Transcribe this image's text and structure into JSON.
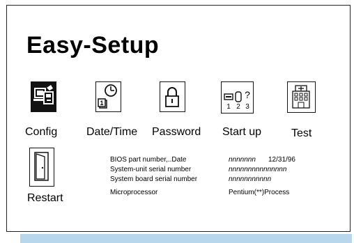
{
  "title": "Easy-Setup",
  "icons": {
    "config": "Config",
    "datetime": "Date/Time",
    "password": "Password",
    "startup": "Start up",
    "test": "Test",
    "restart": "Restart"
  },
  "startup_digits": [
    "1",
    "2",
    "3"
  ],
  "info": [
    {
      "label": "BIOS part number,..Date",
      "value": "nnnnnnn",
      "extra": "12/31/96"
    },
    {
      "label": "System-unit serial number",
      "value": "nnnnnnnnnnnnnnn",
      "extra": ""
    },
    {
      "label": "System board serial number",
      "value": "nnnnnnnnnnn",
      "extra": ""
    },
    {
      "label": "Microprocessor",
      "value": "Pentium(**)Process",
      "extra": ""
    }
  ],
  "colors": {
    "frame": "#222222",
    "bottom_bar": "#b8d6ec",
    "config_icon_bg": "#111111"
  }
}
